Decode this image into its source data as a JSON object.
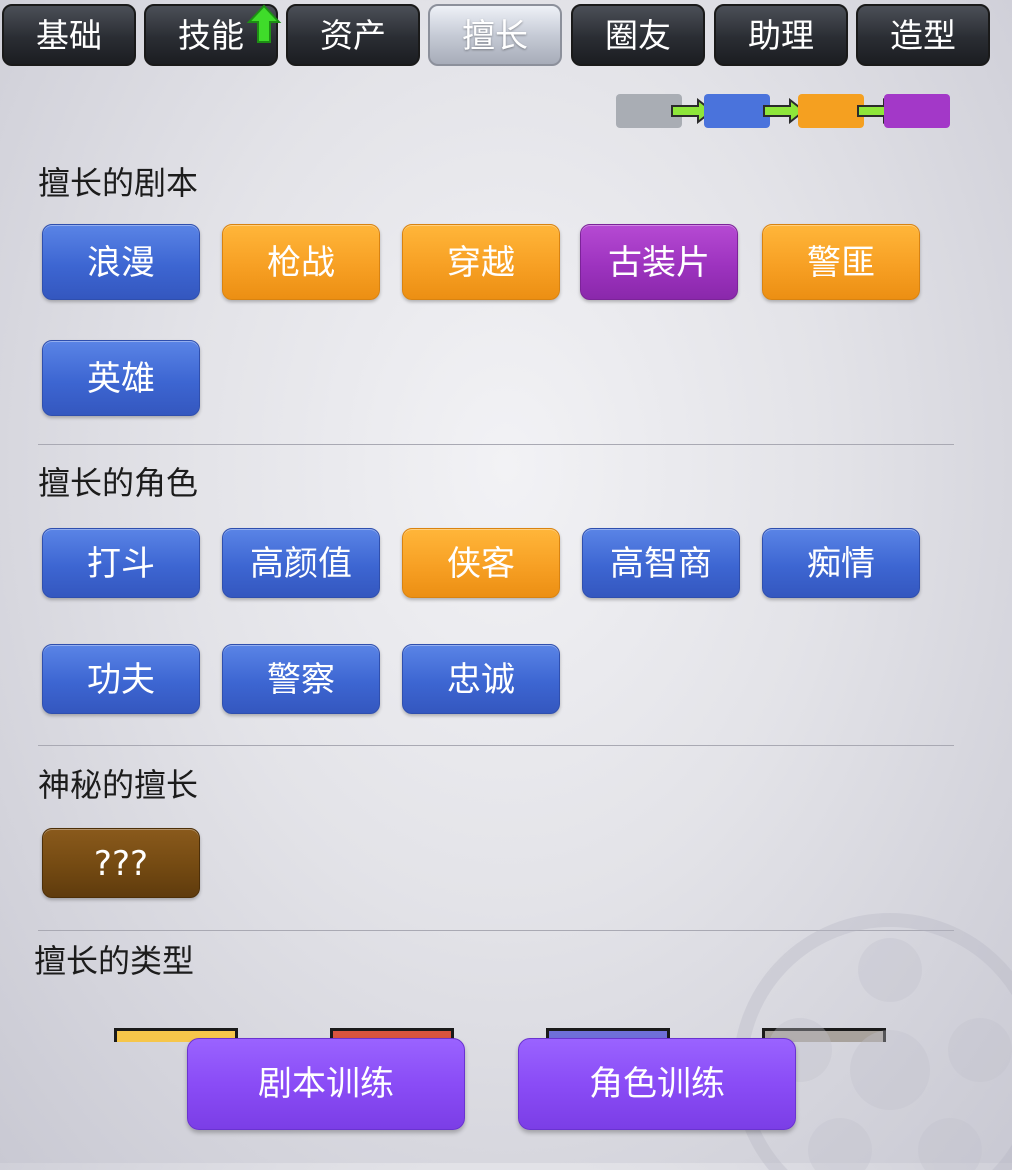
{
  "tabs": [
    "基础",
    "技能",
    "资产",
    "擅长",
    "圈友",
    "助理",
    "造型"
  ],
  "active_tab": "擅长",
  "legend_colors": [
    "#a9adb4",
    "#4a73dc",
    "#f5a020",
    "#a338c8"
  ],
  "sections": {
    "scripts": {
      "title": "擅长的剧本",
      "items": [
        {
          "label": "浪漫",
          "color": "blue"
        },
        {
          "label": "枪战",
          "color": "orange"
        },
        {
          "label": "穿越",
          "color": "orange"
        },
        {
          "label": "古装片",
          "color": "purple"
        },
        {
          "label": "警匪",
          "color": "orange"
        },
        {
          "label": "英雄",
          "color": "blue"
        }
      ]
    },
    "roles": {
      "title": "擅长的角色",
      "items": [
        {
          "label": "打斗",
          "color": "blue"
        },
        {
          "label": "高颜值",
          "color": "blue"
        },
        {
          "label": "侠客",
          "color": "orange"
        },
        {
          "label": "高智商",
          "color": "blue"
        },
        {
          "label": "痴情",
          "color": "blue"
        },
        {
          "label": "功夫",
          "color": "blue"
        },
        {
          "label": "警察",
          "color": "blue"
        },
        {
          "label": "忠诚",
          "color": "blue"
        }
      ]
    },
    "mystery": {
      "title": "神秘的擅长",
      "items": [
        {
          "label": "???",
          "color": "brown"
        }
      ]
    },
    "types": {
      "title": "擅长的类型",
      "box_colors": [
        "#f6c64a",
        "#d9543f",
        "#6f6fd8",
        "#a8a29c"
      ]
    }
  },
  "buttons": {
    "script_training": "剧本训练",
    "role_training": "角色训练"
  }
}
